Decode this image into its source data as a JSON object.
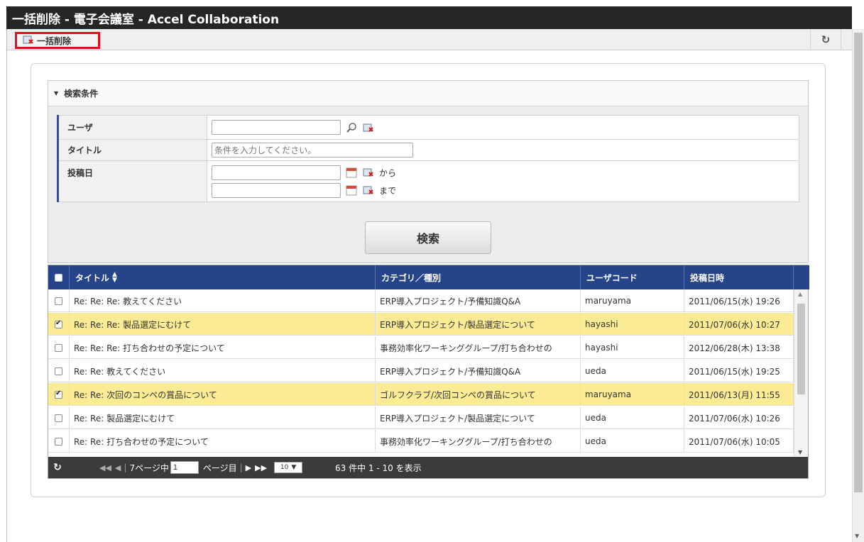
{
  "window": {
    "title": "一括削除 - 電子会議室 - Accel Collaboration"
  },
  "toolbar": {
    "bulk_delete_label": "一括削除"
  },
  "search": {
    "header": "検索条件",
    "user_label": "ユーザ",
    "title_label": "タイトル",
    "title_placeholder": "条件を入力してください。",
    "date_label": "投稿日",
    "from_label": "から",
    "to_label": "まで",
    "button_label": "検索"
  },
  "grid": {
    "columns": [
      "タイトル",
      "カテゴリ／種別",
      "ユーザコード",
      "投稿日時"
    ],
    "rows": [
      {
        "checked": false,
        "title": "Re: Re: Re: 教えてください",
        "category": "ERP導入プロジェクト/予備知識Q&A",
        "user": "maruyama",
        "date": "2011/06/15(水) 19:26"
      },
      {
        "checked": true,
        "title": "Re: Re: Re: 製品選定にむけて",
        "category": "ERP導入プロジェクト/製品選定について",
        "user": "hayashi",
        "date": "2011/07/06(水) 10:27"
      },
      {
        "checked": false,
        "title": "Re: Re: Re: 打ち合わせの予定について",
        "category": "事務効率化ワーキンググループ/打ち合わせの",
        "user": "hayashi",
        "date": "2012/06/28(木) 13:38"
      },
      {
        "checked": false,
        "title": "Re: Re: 教えてください",
        "category": "ERP導入プロジェクト/予備知識Q&A",
        "user": "ueda",
        "date": "2011/06/15(水) 19:25"
      },
      {
        "checked": true,
        "title": "Re: Re: 次回のコンペの賞品について",
        "category": "ゴルフクラブ/次回コンペの賞品について",
        "user": "maruyama",
        "date": "2011/06/13(月) 11:55"
      },
      {
        "checked": false,
        "title": "Re: Re: 製品選定にむけて",
        "category": "ERP導入プロジェクト/製品選定について",
        "user": "ueda",
        "date": "2011/07/06(水) 10:26"
      },
      {
        "checked": false,
        "title": "Re: Re: 打ち合わせの予定について",
        "category": "事務効率化ワーキンググループ/打ち合わせの",
        "user": "ueda",
        "date": "2011/07/06(水) 10:05"
      }
    ]
  },
  "pager": {
    "total_pages_text": "7ページ中",
    "page_value": "1",
    "page_suffix": "ページ目",
    "per_page": "10",
    "summary": "63 件中 1 - 10 を表示"
  }
}
